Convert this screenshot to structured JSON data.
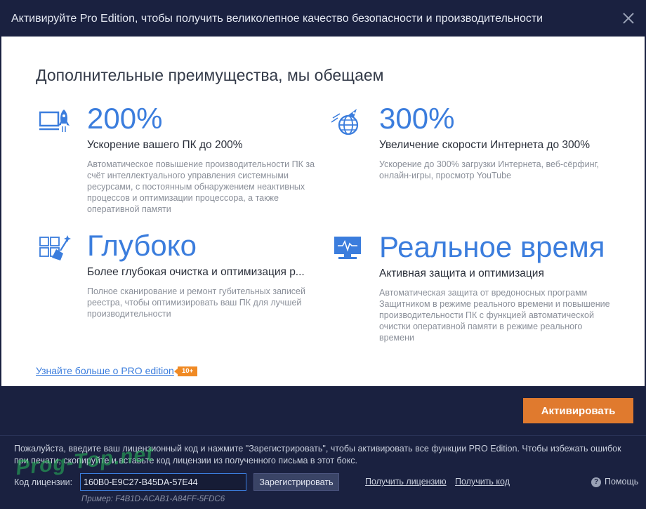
{
  "window": {
    "title": "Активируйте Pro Edition, чтобы получить великолепное качество безопасности и производительности"
  },
  "main": {
    "heading": "Дополнительные преимущества, мы обещаем",
    "features": [
      {
        "big": "200%",
        "subtitle": "Ускорение вашего ПК до 200%",
        "description": "Автоматическое повышение производительности ПК за счёт интеллектуального управления системными ресурсами, с постоянным обнаружением неактивных процессов и оптимизации процессора, а также оперативной памяти",
        "icon": "pc-rocket-icon"
      },
      {
        "big": "300%",
        "subtitle": "Увеличение скорости Интернета до 300%",
        "description": "Ускорение до 300% загрузки Интернета, веб-сёрфинг, онлайн-игры, просмотр YouTube",
        "icon": "globe-rocket-icon"
      },
      {
        "big": "Глубоко",
        "subtitle": "Более глубокая очистка и оптимизация р...",
        "description": "Полное сканирование и ремонт губительных записей реестра, чтобы оптимизировать ваш ПК для лучшей производительности",
        "icon": "registry-broom-icon"
      },
      {
        "big": "Реальное время",
        "subtitle": "Активная защита и оптимизация",
        "description": "Автоматическая защита от вредоносных программ Защитником в режиме реального времени и повышение производительности ПК с функцией автоматической очистки оперативной памяти в режиме реального времени",
        "icon": "monitor-pulse-icon"
      }
    ],
    "learn_more": "Узнайте больше о PRO edition",
    "badge": "10+"
  },
  "footer": {
    "activate_label": "Активировать",
    "info": "Пожалуйста, введите ваш лицензионный код и нажмите \"Зарегистрировать\", чтобы активировать все функции PRO Edition. Чтобы избежать ошибок при печати, скопируйте и вставьте код лицензии из полученного письма в этот бокс.",
    "license_label": "Код лицензии:",
    "license_value": "160B0-E9C27-B45DA-57E44",
    "register_label": "Зарегистрировать",
    "get_license": "Получить лицензию",
    "get_code": "Получить код",
    "help": "Помощь",
    "example": "Пример: F4B1D-ACAB1-A84FF-5FDC6",
    "watermark": "Prog-Top.net"
  },
  "colors": {
    "accent": "#3b7ddd",
    "activate": "#e07a2e",
    "badge": "#f08a24",
    "dark_bg": "#1a2140"
  }
}
